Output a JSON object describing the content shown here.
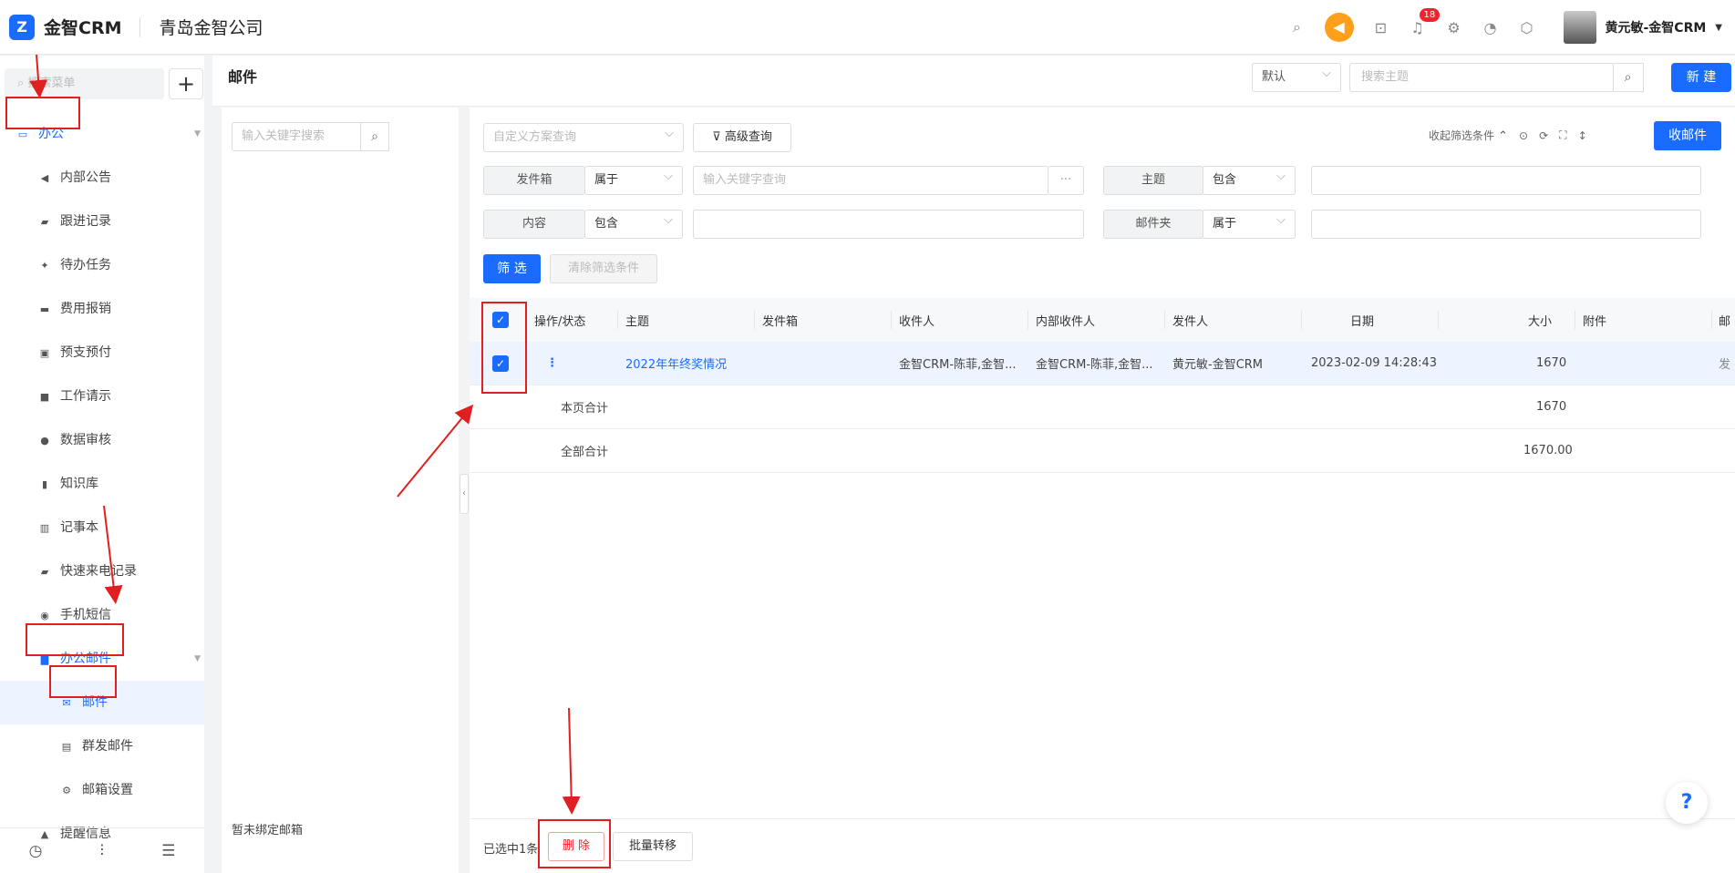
{
  "topbar": {
    "logo_mark": "Z",
    "app_name": "金智CRM",
    "company": "青岛金智公司",
    "notification_count": "18",
    "user_name": "黄元敏-金智CRM"
  },
  "sidebar": {
    "search_placeholder": "搜索菜单",
    "add_label": "+",
    "group_office": "办公",
    "items": [
      {
        "label": "内部公告",
        "icon": "speaker-icon"
      },
      {
        "label": "跟进记录",
        "icon": "edit-icon"
      },
      {
        "label": "待办任务",
        "icon": "pin-icon"
      },
      {
        "label": "费用报销",
        "icon": "card-icon"
      },
      {
        "label": "预支预付",
        "icon": "wallet-icon"
      },
      {
        "label": "工作请示",
        "icon": "message-icon"
      },
      {
        "label": "数据审核",
        "icon": "user-icon"
      },
      {
        "label": "知识库",
        "icon": "book-icon"
      },
      {
        "label": "记事本",
        "icon": "notebook-icon"
      },
      {
        "label": "快速来电记录",
        "icon": "edit-icon"
      },
      {
        "label": "手机短信",
        "icon": "sms-icon"
      }
    ],
    "group_mail": "办公邮件",
    "mail_items": [
      {
        "label": "邮件"
      },
      {
        "label": "群发邮件"
      },
      {
        "label": "邮箱设置"
      }
    ],
    "reminder": "提醒信息"
  },
  "header": {
    "title": "邮件",
    "view_select": "默认",
    "search_placeholder": "搜索主题",
    "new_button": "新 建"
  },
  "left_panel": {
    "search_placeholder": "输入关键字搜索",
    "empty_text": "暂未绑定邮箱"
  },
  "filters": {
    "scheme_placeholder": "自定义方案查询",
    "advanced": "高级查询",
    "collapse": "收起筛选条件",
    "receive_button": "收邮件",
    "row1": {
      "label1": "发件箱",
      "op1": "属于",
      "value1_placeholder": "输入关键字查询",
      "more": "···",
      "label2": "主题",
      "op2": "包含"
    },
    "row2": {
      "label1": "内容",
      "op1": "包含",
      "label2": "邮件夹",
      "op2": "属于"
    },
    "filter_button": "筛 选",
    "clear_button": "清除筛选条件"
  },
  "table": {
    "columns": [
      "操作/状态",
      "主题",
      "发件箱",
      "收件人",
      "内部收件人",
      "发件人",
      "日期",
      "大小",
      "附件",
      "邮"
    ],
    "rows": [
      {
        "action": "⋮",
        "subject": "2022年年终奖情况",
        "outbox": "",
        "recipients": "金智CRM-陈菲,金智...",
        "internal": "金智CRM-陈菲,金智...",
        "sender": "黄元敏-金智CRM",
        "date": "2023-02-09 14:28:43",
        "size": "1670",
        "attach": "",
        "extra": "发"
      }
    ],
    "page_total_label": "本页合计",
    "page_total": "1670",
    "grand_total_label": "全部合计",
    "grand_total": "1670.00"
  },
  "footer": {
    "selected": "已选中1条",
    "delete": "删 除",
    "batch_move": "批量转移"
  },
  "help": "?"
}
